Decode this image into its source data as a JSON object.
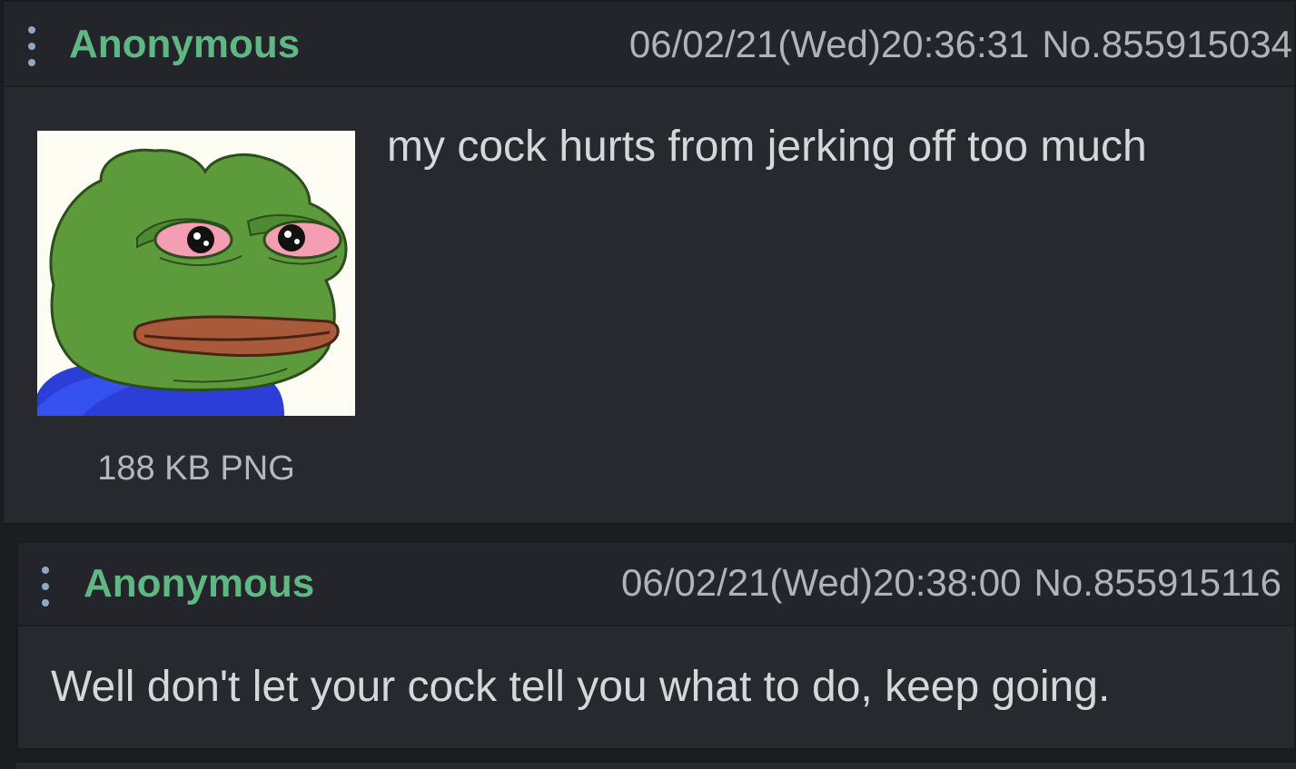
{
  "posts": [
    {
      "name": "Anonymous",
      "datetime": "06/02/21(Wed)20:36:31",
      "number": "No.855915034",
      "file": {
        "info": "188 KB PNG",
        "thumbnail": "sad-frog-image"
      },
      "comment": "my cock hurts from jerking off too much"
    },
    {
      "name": "Anonymous",
      "datetime": "06/02/21(Wed)20:38:00",
      "number": "No.855915116",
      "comment": "Well don't let your cock tell you what to do, keep going."
    }
  ],
  "icons": {
    "menu": "vertical-dots-icon"
  },
  "colors": {
    "background": "#1c1d20",
    "post_bg": "#27292e",
    "header_bg": "#23252a",
    "name": "#5fb883",
    "meta": "#b0b3b8",
    "body_text": "#d5d7da",
    "menu_dots": "#8ea9c6"
  }
}
